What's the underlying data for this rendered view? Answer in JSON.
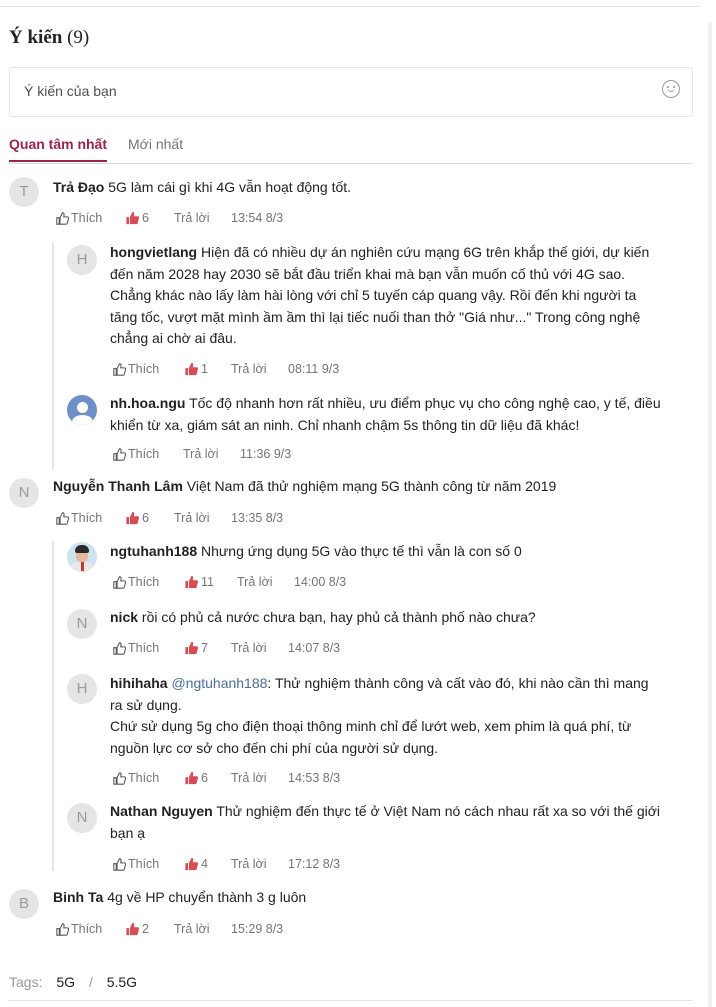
{
  "header": {
    "title": "Ý kiến",
    "count": "(9)"
  },
  "input": {
    "placeholder": "Ý kiến của bạn",
    "emoji_icon": "smile-icon"
  },
  "tabs": [
    {
      "label": "Quan tâm nhất",
      "active": true
    },
    {
      "label": "Mới nhất",
      "active": false
    }
  ],
  "action_labels": {
    "like": "Thích",
    "reply": "Trả lời"
  },
  "comments": [
    {
      "initial": "T",
      "name": "Trả Đạo",
      "text": "5G làm cái gì khi 4G vẫn hoạt động tốt.",
      "likes": "6",
      "time": "13:54 8/3"
    },
    {
      "initial": "H",
      "name": "hongvietlang",
      "text": "Hiện đã có nhiều dự án nghiên cứu mạng 6G trên khắp thế giới, dự kiến",
      "lines": [
        "đến năm 2028 hay 2030 sẽ bắt đầu triển khai mà bạn vẫn muốn cố thủ với 4G sao.",
        "Chẳng khác nào lấy làm hài lòng với chỉ 5 tuyến cáp quang vậy. Rồi đến khi người ta",
        "tăng tốc, vượt mặt mình ầm ầm thì lại tiếc nuối than thở \"Giá như...\" Trong công nghệ",
        "chẳng ai chờ ai đâu."
      ],
      "likes": "1",
      "time": "08:11 9/3"
    },
    {
      "initial": "",
      "name": "nh.hoa.ngu",
      "text": "Tốc độ nhanh hơn rất nhiều, ưu điểm phục vụ cho công nghệ cao, y tế, điều",
      "lines": [
        "khiển từ xa, giám sát an ninh. Chỉ nhanh chậm 5s thông tin dữ liệu đã khác!"
      ],
      "likes": "",
      "time": "11:36 9/3"
    },
    {
      "initial": "N",
      "name": "Nguyễn Thanh Lâm",
      "text": "Việt Nam đã thử nghiệm mạng 5G thành công từ năm 2019",
      "likes": "6",
      "time": "13:35 8/3"
    },
    {
      "initial": "",
      "name": "ngtuhanh188",
      "text": "Nhưng ứng dụng 5G vào thực tế thì vẫn là con số 0",
      "likes": "11",
      "time": "14:00 8/3"
    },
    {
      "initial": "N",
      "name": "nick",
      "text": "rồi có phủ cả nước chưa bạn, hay phủ cả thành phố nào chưa?",
      "likes": "7",
      "time": "14:07 8/3"
    },
    {
      "initial": "H",
      "name": "hihihaha",
      "mention": "@ngtuhanh188",
      "text": ": Thử nghiệm thành công và cất vào đó, khi nào cần thì mang",
      "lines": [
        "ra sử dụng.",
        "Chứ sử dụng 5g cho điện thoại thông minh chỉ để lướt web, xem phim là quá phí, từ",
        "nguồn lực cơ sở cho đến chi phí của người sử dụng."
      ],
      "likes": "6",
      "time": "14:53 8/3"
    },
    {
      "initial": "N",
      "name": "Nathan Nguyen",
      "text": "Thử nghiệm đến thực tế ở Việt Nam nó cách nhau rất xa so với thế giới",
      "lines": [
        "bạn ạ"
      ],
      "likes": "4",
      "time": "17:12 8/3"
    },
    {
      "initial": "B",
      "name": "Binh Ta",
      "text": "4g về HP chuyển thành 3 g luôn",
      "likes": "2",
      "time": "15:29 8/3"
    }
  ],
  "tags": {
    "label": "Tags:",
    "items": [
      "5G",
      "5.5G"
    ],
    "separator": "/"
  },
  "colors": {
    "accent": "#9f224e",
    "like_icon": "#d84c56",
    "muted": "#757575"
  }
}
